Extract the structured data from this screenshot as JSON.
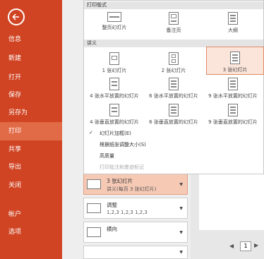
{
  "sidebar": {
    "accent": "#d04423",
    "active_bg": "#e26b47",
    "items": [
      {
        "label": "信息"
      },
      {
        "label": "新建"
      },
      {
        "label": "打开"
      },
      {
        "label": "保存"
      },
      {
        "label": "另存为"
      },
      {
        "label": "打印"
      },
      {
        "label": "共享"
      },
      {
        "label": "导出"
      },
      {
        "label": "关闭"
      },
      {
        "label": "帐户"
      },
      {
        "label": "选项"
      }
    ]
  },
  "dropdown": {
    "print_layout_header": "打印版式",
    "print_layout": [
      {
        "label": "整页幻灯片",
        "icon": "full-slide-icon"
      },
      {
        "label": "备注页",
        "icon": "notes-page-icon"
      },
      {
        "label": "大纲",
        "icon": "outline-icon"
      }
    ],
    "handouts_header": "讲义",
    "handouts": [
      {
        "label": "1 张幻灯片",
        "icon": "handout-1-icon"
      },
      {
        "label": "2 张幻灯片",
        "icon": "handout-2-icon"
      },
      {
        "label": "3 张幻灯片",
        "icon": "handout-3-icon",
        "selected": true
      },
      {
        "label": "4 张水平放置的幻灯片",
        "icon": "handout-4h-icon"
      },
      {
        "label": "6 张水平放置的幻灯片",
        "icon": "handout-6h-icon"
      },
      {
        "label": "9 张水平放置的幻灯片",
        "icon": "handout-9h-icon"
      },
      {
        "label": "4 张垂直放置的幻灯片",
        "icon": "handout-4v-icon"
      },
      {
        "label": "6 张垂直放置的幻灯片",
        "icon": "handout-6v-icon"
      },
      {
        "label": "9 张垂直放置的幻灯片",
        "icon": "handout-9v-icon"
      }
    ],
    "menu": [
      {
        "label": "幻灯片加框(E)",
        "checked": true,
        "enabled": true
      },
      {
        "label": "根据纸张调整大小(S)",
        "checked": false,
        "enabled": true
      },
      {
        "label": "高质量",
        "checked": false,
        "enabled": true
      },
      {
        "label": "打印批注和墨迹标记",
        "checked": false,
        "enabled": false
      }
    ]
  },
  "settings": [
    {
      "title": "3 张幻灯片",
      "subtitle": "讲义(每页 3 张幻灯片)",
      "icon": "handout-3-icon",
      "highlight": true
    },
    {
      "title": "调整",
      "subtitle": "1,2,3    1,2,3    1,2,3",
      "icon": "collate-icon",
      "highlight": false
    },
    {
      "title": "横向",
      "subtitle": "",
      "icon": "landscape-icon",
      "highlight": false
    }
  ],
  "pager": {
    "current": "1"
  }
}
